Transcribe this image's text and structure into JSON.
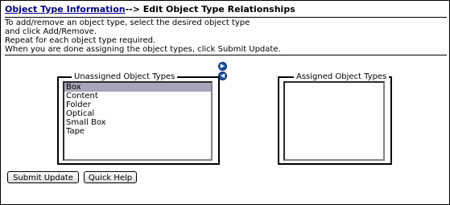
{
  "header": {
    "link": "Object Type Information",
    "separator": "-->",
    "title": "Edit Object Type Relationships"
  },
  "instructions": [
    "To add/remove an object type, select the desired object type",
    "and click Add/Remove.",
    "Repeat for each object type required.",
    "When you are done assigning the object types, click Submit Update."
  ],
  "unassigned": {
    "legend": "Unassigned Object Types",
    "items": [
      "Box",
      "Content",
      "Folder",
      "Optical",
      "Small Box",
      "Tape"
    ],
    "selected": "Box"
  },
  "assigned": {
    "legend": "Assigned Object Types",
    "items": []
  },
  "buttons": {
    "submit": "Submit Update",
    "help": "Quick Help"
  },
  "icons": {
    "add": "arrow-right-icon",
    "remove": "arrow-left-icon"
  }
}
